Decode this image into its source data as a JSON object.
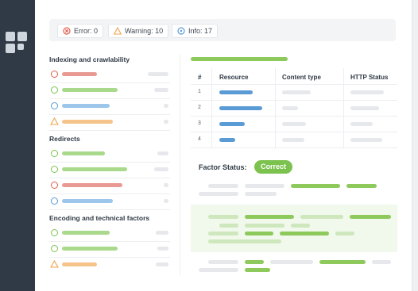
{
  "rail": {
    "logo_icon": "grid-logo-icon"
  },
  "summary": {
    "error_label": "Error: 0",
    "warning_label": "Warning: 10",
    "info_label": "Info: 17"
  },
  "sections": [
    {
      "title": "Indexing and crawlability"
    },
    {
      "title": "Redirects"
    },
    {
      "title": "Encoding and technical factors"
    }
  ],
  "table": {
    "headers": [
      "#",
      "Resource",
      "Content type",
      "HTTP Status"
    ],
    "rows": [
      "1",
      "2",
      "3",
      "4"
    ]
  },
  "factor_status": {
    "label": "Factor Status:",
    "value": "Correct"
  },
  "colors": {
    "green": "#7cc24f",
    "red": "#e25b4b",
    "blue": "#5b9bd5",
    "orange": "#f0a34a"
  }
}
